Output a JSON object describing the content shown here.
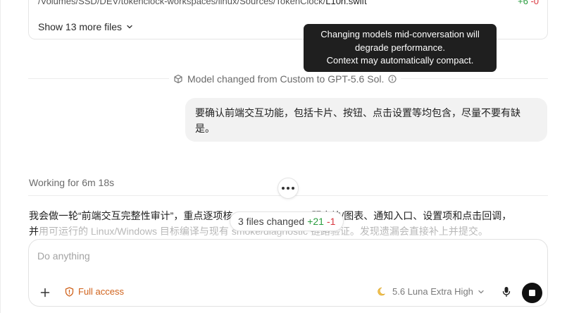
{
  "file_card": {
    "path_prefix": "/Volumes/SSD/DEV/tokenclock-workspaces/linux/Sources/TokenClock/",
    "file_name": "L10n.swift",
    "additions": "+6",
    "deletions": "-0",
    "show_more_label": "Show 13 more files"
  },
  "tooltip": {
    "line1": "Changing models mid-conversation will",
    "line2": "degrade performance.",
    "line3": "Context may automatically compact."
  },
  "model_change": {
    "text": "Model changed from Custom to GPT-5.6 Sol."
  },
  "user_message": {
    "text": "要确认前端交互功能，包括卡片、按钮、点击设置等均包含，尽量不要有缺是。"
  },
  "working": {
    "label": "Working for 6m 18s"
  },
  "summary": {
    "line1": "我会做一轮“前端交互完整性审计”，重点逐项核",
    "line1_tail": "明方块/图表、通知入口、设置项和点击回调，",
    "line2_head": "并",
    "line2_fade": "用可运行的 Linux/Windows 目标编译与现有 smoke/diagnostic 链路验证。发现遗漏会直接补上并提交。"
  },
  "files_pill": {
    "label": "3 files changed",
    "additions": "+21",
    "deletions": "-1"
  },
  "composer": {
    "placeholder": "Do anything",
    "access_label": "Full access",
    "model_label": "5.6 Luna Extra High"
  },
  "colors": {
    "accent_orange": "#d0621b",
    "add_green": "#2a9d3f",
    "del_red": "#d9363e"
  }
}
